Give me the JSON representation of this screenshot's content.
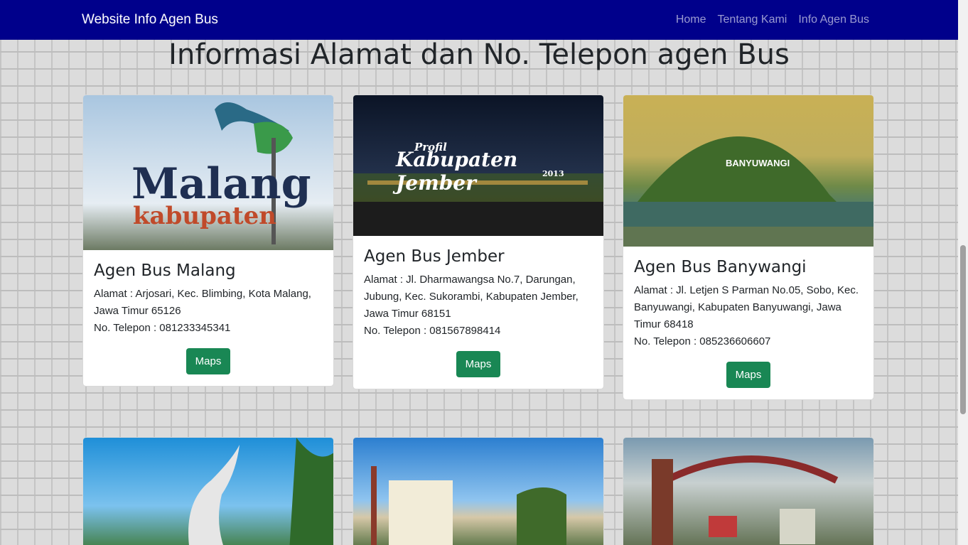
{
  "nav": {
    "brand": "Website Info Agen Bus",
    "links": [
      "Home",
      "Tentang Kami",
      "Info Agen Bus"
    ]
  },
  "heading": "Informasi Alamat dan No. Telepon agen Bus",
  "cards": [
    {
      "title": "Agen Bus Malang",
      "address": "Alamat : Arjosari, Kec. Blimbing, Kota Malang, Jawa Timur 65126",
      "phone": "No. Telepon : 081233345341",
      "button": "Maps",
      "image_text": "Malang",
      "image_sub": "kabupaten"
    },
    {
      "title": "Agen Bus Jember",
      "address": "Alamat : Jl. Dharmawangsa No.7, Darungan, Jubung, Kec. Sukorambi, Kabupaten Jember, Jawa Timur 68151",
      "phone": "No. Telepon : 081567898414",
      "button": "Maps",
      "image_text": "Kabupaten Jember",
      "image_sub": "Profil",
      "image_year": "2013"
    },
    {
      "title": "Agen Bus Banywangi",
      "address": "Alamat : Jl. Letjen S Parman No.05, Sobo, Kec. Banyuwangi, Kabupaten Banyuwangi, Jawa Timur 68418",
      "phone": "No. Telepon : 085236606607",
      "button": "Maps",
      "image_text": "BANYUWANGI"
    }
  ]
}
